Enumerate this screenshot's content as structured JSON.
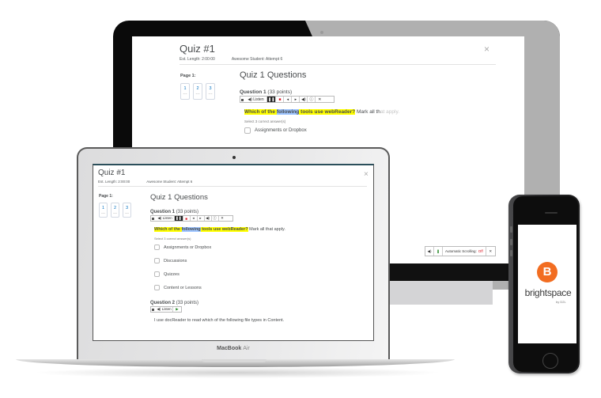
{
  "quiz": {
    "title": "Quiz #1",
    "est_length": "Est. Length: 2:00:00",
    "attempt": "Awesome Student: Attempt 6",
    "close_icon": "×",
    "pages_label": "Page 1:",
    "pages": [
      {
        "num": "1",
        "status": "---"
      },
      {
        "num": "2",
        "status": "---"
      },
      {
        "num": "3",
        "status": "---"
      }
    ],
    "heading": "Quiz 1 Questions",
    "question1": {
      "label": "Question 1",
      "points": "(33 points)",
      "text_part1": "Which of the ",
      "text_highlight_word": "following",
      "text_part2": " tools use webReader?",
      "text_rest": " Mark all that apply.",
      "text_rest_monitor_a": " Mark all th",
      "text_rest_monitor_b": "at apply.",
      "hint": "Select 3 correct answer(s)",
      "options": [
        "Assignments or Dropbox",
        "Discussions",
        "Quizzes",
        "Content or Lessons"
      ]
    },
    "question2": {
      "label": "Question 2",
      "points": "(33 points)",
      "text": "I use docReader to read which of the following file types in Content."
    },
    "toolbar": {
      "listen": "◀) Listen",
      "pause": "❚❚",
      "stop": "■",
      "prev": "◂",
      "next": "▸",
      "volume": "◀)",
      "info": "ⓘ",
      "close": "✕",
      "play": "▶"
    }
  },
  "monitor": {
    "partial_text": "ent.",
    "autoscroll": {
      "speaker": "◀)",
      "pause": "❚",
      "label": "Automatic Scrolling:",
      "state": "Off",
      "close": "✕"
    }
  },
  "laptop": {
    "brand": "MacBook",
    "model": "Air"
  },
  "phone": {
    "logo_letter": "B",
    "brand": "brightspace",
    "byline": "by D2L",
    "brand_color": "#f26d21"
  }
}
